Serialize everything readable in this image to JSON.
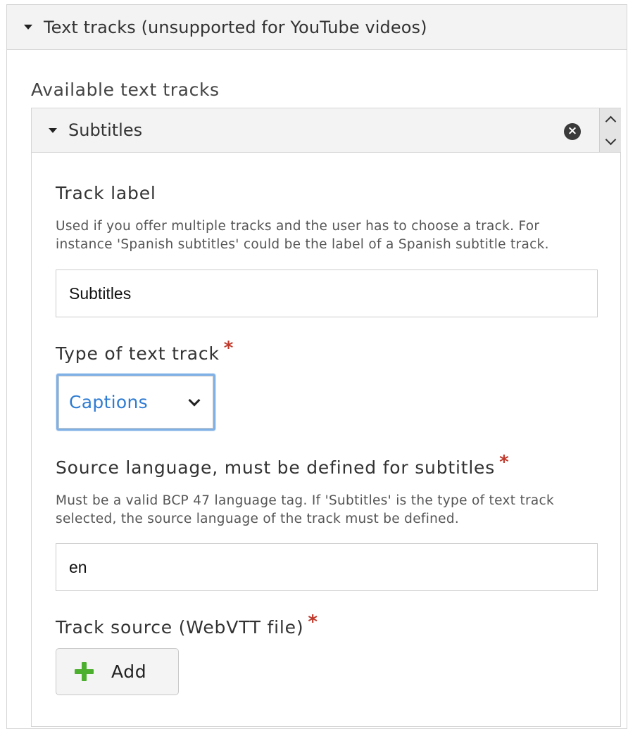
{
  "header": {
    "title": "Text tracks (unsupported for YouTube videos)",
    "expand_icon": "caret-down-icon"
  },
  "available": {
    "label": "Available text tracks",
    "item": {
      "title": "Subtitles",
      "remove_icon": "circle-x-icon",
      "order_up_icon": "chevron-up-icon",
      "order_down_icon": "chevron-down-icon"
    }
  },
  "fields": {
    "track_label": {
      "label": "Track label",
      "description": "Used if you offer multiple tracks and the user has to choose a track. For instance 'Spanish subtitles' could be the label of a Spanish subtitle track.",
      "value": "Subtitles"
    },
    "track_type": {
      "label": "Type of text track",
      "required_marker": "*",
      "selected": "Captions"
    },
    "source_language": {
      "label": "Source language, must be defined for subtitles",
      "required_marker": "*",
      "description": "Must be a valid BCP 47 language tag. If 'Subtitles' is the type of text track selected, the source language of the track must be defined.",
      "value": "en"
    },
    "track_source": {
      "label": "Track source (WebVTT file)",
      "required_marker": "*",
      "add_label": "Add",
      "add_icon": "plus-icon"
    }
  },
  "colors": {
    "accent": "#2f7cd3",
    "required": "#c0392b",
    "add_icon": "#4caf2e",
    "header_bg": "#f3f3f3"
  }
}
